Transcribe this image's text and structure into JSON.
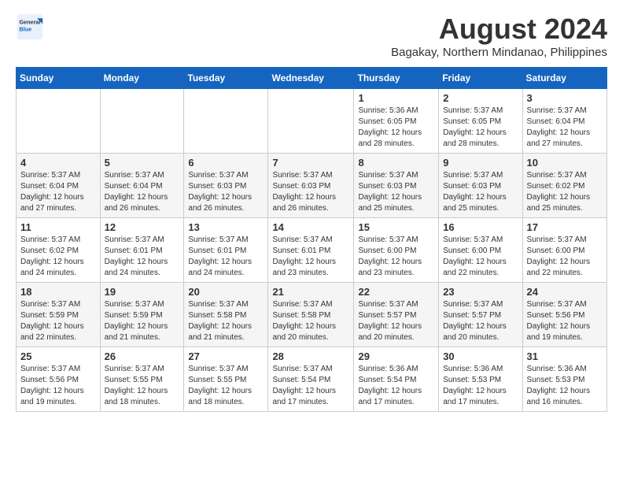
{
  "logo": {
    "general": "General",
    "blue": "Blue"
  },
  "title": "August 2024",
  "subtitle": "Bagakay, Northern Mindanao, Philippines",
  "days_of_week": [
    "Sunday",
    "Monday",
    "Tuesday",
    "Wednesday",
    "Thursday",
    "Friday",
    "Saturday"
  ],
  "weeks": [
    [
      {
        "day": "",
        "info": ""
      },
      {
        "day": "",
        "info": ""
      },
      {
        "day": "",
        "info": ""
      },
      {
        "day": "",
        "info": ""
      },
      {
        "day": "1",
        "info": "Sunrise: 5:36 AM\nSunset: 6:05 PM\nDaylight: 12 hours and 28 minutes."
      },
      {
        "day": "2",
        "info": "Sunrise: 5:37 AM\nSunset: 6:05 PM\nDaylight: 12 hours and 28 minutes."
      },
      {
        "day": "3",
        "info": "Sunrise: 5:37 AM\nSunset: 6:04 PM\nDaylight: 12 hours and 27 minutes."
      }
    ],
    [
      {
        "day": "4",
        "info": "Sunrise: 5:37 AM\nSunset: 6:04 PM\nDaylight: 12 hours and 27 minutes."
      },
      {
        "day": "5",
        "info": "Sunrise: 5:37 AM\nSunset: 6:04 PM\nDaylight: 12 hours and 26 minutes."
      },
      {
        "day": "6",
        "info": "Sunrise: 5:37 AM\nSunset: 6:03 PM\nDaylight: 12 hours and 26 minutes."
      },
      {
        "day": "7",
        "info": "Sunrise: 5:37 AM\nSunset: 6:03 PM\nDaylight: 12 hours and 26 minutes."
      },
      {
        "day": "8",
        "info": "Sunrise: 5:37 AM\nSunset: 6:03 PM\nDaylight: 12 hours and 25 minutes."
      },
      {
        "day": "9",
        "info": "Sunrise: 5:37 AM\nSunset: 6:03 PM\nDaylight: 12 hours and 25 minutes."
      },
      {
        "day": "10",
        "info": "Sunrise: 5:37 AM\nSunset: 6:02 PM\nDaylight: 12 hours and 25 minutes."
      }
    ],
    [
      {
        "day": "11",
        "info": "Sunrise: 5:37 AM\nSunset: 6:02 PM\nDaylight: 12 hours and 24 minutes."
      },
      {
        "day": "12",
        "info": "Sunrise: 5:37 AM\nSunset: 6:01 PM\nDaylight: 12 hours and 24 minutes."
      },
      {
        "day": "13",
        "info": "Sunrise: 5:37 AM\nSunset: 6:01 PM\nDaylight: 12 hours and 24 minutes."
      },
      {
        "day": "14",
        "info": "Sunrise: 5:37 AM\nSunset: 6:01 PM\nDaylight: 12 hours and 23 minutes."
      },
      {
        "day": "15",
        "info": "Sunrise: 5:37 AM\nSunset: 6:00 PM\nDaylight: 12 hours and 23 minutes."
      },
      {
        "day": "16",
        "info": "Sunrise: 5:37 AM\nSunset: 6:00 PM\nDaylight: 12 hours and 22 minutes."
      },
      {
        "day": "17",
        "info": "Sunrise: 5:37 AM\nSunset: 6:00 PM\nDaylight: 12 hours and 22 minutes."
      }
    ],
    [
      {
        "day": "18",
        "info": "Sunrise: 5:37 AM\nSunset: 5:59 PM\nDaylight: 12 hours and 22 minutes."
      },
      {
        "day": "19",
        "info": "Sunrise: 5:37 AM\nSunset: 5:59 PM\nDaylight: 12 hours and 21 minutes."
      },
      {
        "day": "20",
        "info": "Sunrise: 5:37 AM\nSunset: 5:58 PM\nDaylight: 12 hours and 21 minutes."
      },
      {
        "day": "21",
        "info": "Sunrise: 5:37 AM\nSunset: 5:58 PM\nDaylight: 12 hours and 20 minutes."
      },
      {
        "day": "22",
        "info": "Sunrise: 5:37 AM\nSunset: 5:57 PM\nDaylight: 12 hours and 20 minutes."
      },
      {
        "day": "23",
        "info": "Sunrise: 5:37 AM\nSunset: 5:57 PM\nDaylight: 12 hours and 20 minutes."
      },
      {
        "day": "24",
        "info": "Sunrise: 5:37 AM\nSunset: 5:56 PM\nDaylight: 12 hours and 19 minutes."
      }
    ],
    [
      {
        "day": "25",
        "info": "Sunrise: 5:37 AM\nSunset: 5:56 PM\nDaylight: 12 hours and 19 minutes."
      },
      {
        "day": "26",
        "info": "Sunrise: 5:37 AM\nSunset: 5:55 PM\nDaylight: 12 hours and 18 minutes."
      },
      {
        "day": "27",
        "info": "Sunrise: 5:37 AM\nSunset: 5:55 PM\nDaylight: 12 hours and 18 minutes."
      },
      {
        "day": "28",
        "info": "Sunrise: 5:37 AM\nSunset: 5:54 PM\nDaylight: 12 hours and 17 minutes."
      },
      {
        "day": "29",
        "info": "Sunrise: 5:36 AM\nSunset: 5:54 PM\nDaylight: 12 hours and 17 minutes."
      },
      {
        "day": "30",
        "info": "Sunrise: 5:36 AM\nSunset: 5:53 PM\nDaylight: 12 hours and 17 minutes."
      },
      {
        "day": "31",
        "info": "Sunrise: 5:36 AM\nSunset: 5:53 PM\nDaylight: 12 hours and 16 minutes."
      }
    ]
  ]
}
